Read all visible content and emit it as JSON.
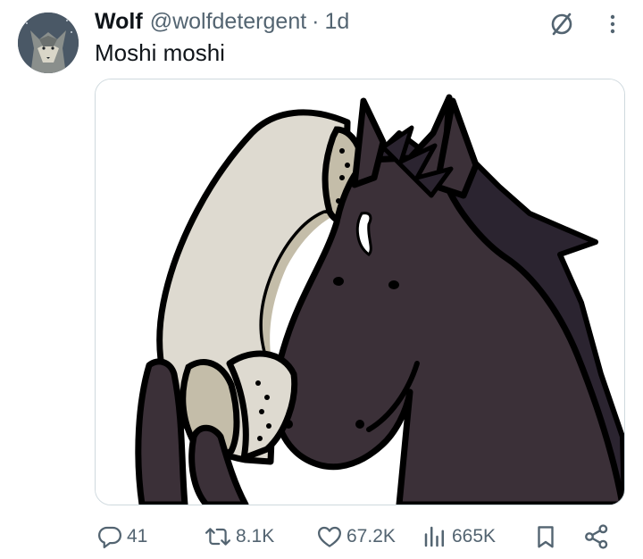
{
  "tweet": {
    "author_name": "Wolf",
    "author_handle": "@wolfdetergent",
    "separator": "·",
    "timestamp": "1d",
    "text": "Moshi moshi",
    "media_alt": "Cartoon of a dark horse holding a phone receiver to its ear"
  },
  "actions": {
    "replies": "41",
    "reposts": "8.1K",
    "likes": "67.2K",
    "views": "665K"
  },
  "icons": {
    "grok": "grok-icon",
    "more": "more-dots-icon",
    "reply": "reply-icon",
    "repost": "repost-icon",
    "like": "heart-icon",
    "views": "views-icon",
    "bookmark": "bookmark-icon",
    "share": "share-icon"
  },
  "colors": {
    "text_primary": "#0f1419",
    "text_secondary": "#536471",
    "border": "#cfd9de",
    "horse_body": "#3b3038",
    "phone": "#dedad0"
  }
}
